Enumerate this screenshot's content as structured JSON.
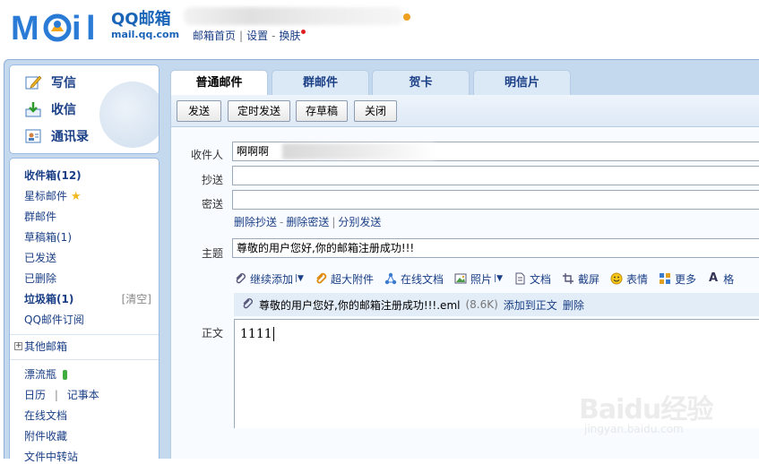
{
  "header": {
    "logo_cn": "QQ邮箱",
    "logo_domain": "mail.qq.com",
    "links": [
      "邮箱首页",
      "设置",
      "换肤"
    ],
    "sep": "|",
    "dash": "-"
  },
  "sidebar": {
    "actions": [
      {
        "label": "写信",
        "icon": "pencil-icon"
      },
      {
        "label": "收信",
        "icon": "inbox-download-icon"
      },
      {
        "label": "通讯录",
        "icon": "contacts-icon"
      }
    ],
    "folders": {
      "inbox": "收件箱(12)",
      "starred": "星标邮件",
      "group": "群邮件",
      "drafts": "草稿箱(1)",
      "sent": "已发送",
      "deleted": "已删除",
      "spam": "垃圾箱(1)",
      "spam_clear": "[清空]",
      "subscription": "QQ邮件订阅"
    },
    "other_mailbox": "其他邮箱",
    "tools": {
      "bottle": "漂流瓶",
      "calendar": "日历",
      "tools_sep": "|",
      "notes": "记事本",
      "docs": "在线文档",
      "attachments": "附件收藏",
      "transfer": "文件中转站"
    }
  },
  "compose": {
    "tabs": [
      "普通邮件",
      "群邮件",
      "贺卡",
      "明信片"
    ],
    "active_tab": 0,
    "buttons": {
      "send": "发送",
      "scheduled": "定时发送",
      "save_draft": "存草稿",
      "close": "关闭"
    },
    "labels": {
      "to": "收件人",
      "cc": "抄送",
      "bcc": "密送",
      "subject": "主题",
      "body": "正文"
    },
    "to_value": "啊啊啊",
    "cc_value": "",
    "bcc_value": "",
    "field_links": [
      "删除抄送",
      "删除密送",
      "分别发送"
    ],
    "subject_value": "尊敬的用户您好,你的邮箱注册成功!!!",
    "attach_toolbar": [
      {
        "label": "继续添加",
        "icon": "paperclip-icon",
        "dropdown": true
      },
      {
        "label": "超大附件",
        "icon": "paperclip-large-icon",
        "dropdown": false
      },
      {
        "label": "在线文档",
        "icon": "share-nodes-icon",
        "dropdown": false
      },
      {
        "label": "照片",
        "icon": "photo-icon",
        "dropdown": true
      },
      {
        "label": "文档",
        "icon": "document-icon",
        "dropdown": false
      },
      {
        "label": "截屏",
        "icon": "screenshot-icon",
        "dropdown": false
      },
      {
        "label": "表情",
        "icon": "smiley-icon",
        "dropdown": false
      },
      {
        "label": "更多",
        "icon": "grid-icon",
        "dropdown": false
      },
      {
        "label": "格",
        "icon": "format-a-icon",
        "dropdown": false
      }
    ],
    "attachment": {
      "name": "尊敬的用户您好,你的邮箱注册成功!!!.eml",
      "size": "(8.6K)",
      "add_to_body": "添加到正文",
      "delete": "删除"
    },
    "body_text": "1111"
  },
  "watermark": {
    "main": "Baidu经验",
    "sub": "jingyan.baidu.com"
  },
  "colors": {
    "link": "#1a3f86",
    "brand": "#1a64b8",
    "frame": "#c4d8ee"
  }
}
